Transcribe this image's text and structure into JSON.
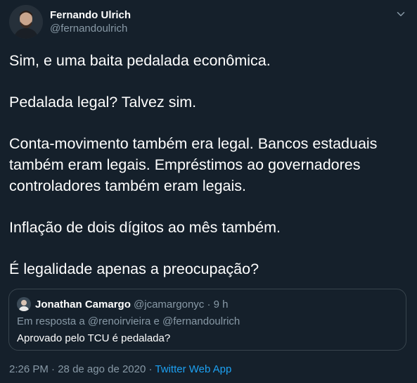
{
  "author": {
    "name": "Fernando Ulrich",
    "handle": "@fernandoulrich"
  },
  "tweet": {
    "paragraphs": [
      "Sim, e uma baita pedalada econômica.",
      "Pedalada legal? Talvez sim.",
      "Conta-movimento também era legal. Bancos estaduais também eram legais. Empréstimos ao governadores controladores também eram legais.",
      "Inflação de dois dígitos ao mês também.",
      "É legalidade apenas a preocupação?"
    ]
  },
  "quote": {
    "name": "Jonathan Camargo",
    "handle": "@jcamargonyc",
    "separator": "·",
    "time": "9 h",
    "replying_to": "Em resposta a @renoirvieira e @fernandoulrich",
    "text": "Aprovado pelo TCU é pedalada?"
  },
  "meta": {
    "time": "2:26 PM",
    "separator": "·",
    "date": "28 de ago de 2020",
    "source": "Twitter Web App"
  },
  "icons": {
    "menu": "chevron-down-icon"
  },
  "colors": {
    "background": "#15202b",
    "text": "#ffffff",
    "secondary": "#8899a6",
    "accent": "#1da1f2",
    "border": "#38444d"
  }
}
